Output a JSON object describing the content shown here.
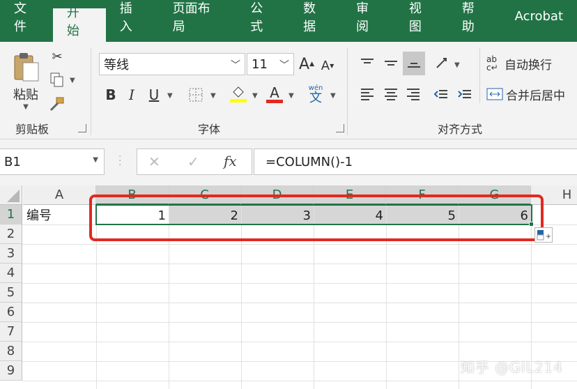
{
  "tabs": [
    "文件",
    "开始",
    "插入",
    "页面布局",
    "公式",
    "数据",
    "审阅",
    "视图",
    "帮助",
    "Acrobat"
  ],
  "active_tab": "开始",
  "clipboard": {
    "paste_label": "粘贴",
    "group_label": "剪贴板"
  },
  "font": {
    "name": "等线",
    "size": "11",
    "group_label": "字体",
    "bold": "B",
    "italic": "I",
    "underline": "U",
    "grow": "A",
    "shrink": "A",
    "wen": "wén",
    "wen_char": "文",
    "font_color": "#e02a20",
    "fill_color": "#ffff00"
  },
  "alignment": {
    "wrap_label": "自动换行",
    "merge_label": "合并后居中",
    "group_label": "对齐方式"
  },
  "formula_bar": {
    "name_box": "B1",
    "cancel": "✕",
    "enter": "✓",
    "fx": "fx",
    "formula": "=COLUMN()-1"
  },
  "sheet": {
    "columns": [
      "A",
      "B",
      "C",
      "D",
      "E",
      "F",
      "G",
      "H"
    ],
    "rows": [
      "1",
      "2",
      "3",
      "4",
      "5",
      "6",
      "7",
      "8",
      "9"
    ],
    "a1": "编号",
    "row1_values": [
      "1",
      "2",
      "3",
      "4",
      "5",
      "6"
    ]
  },
  "watermark": "知乎 @GIL214"
}
